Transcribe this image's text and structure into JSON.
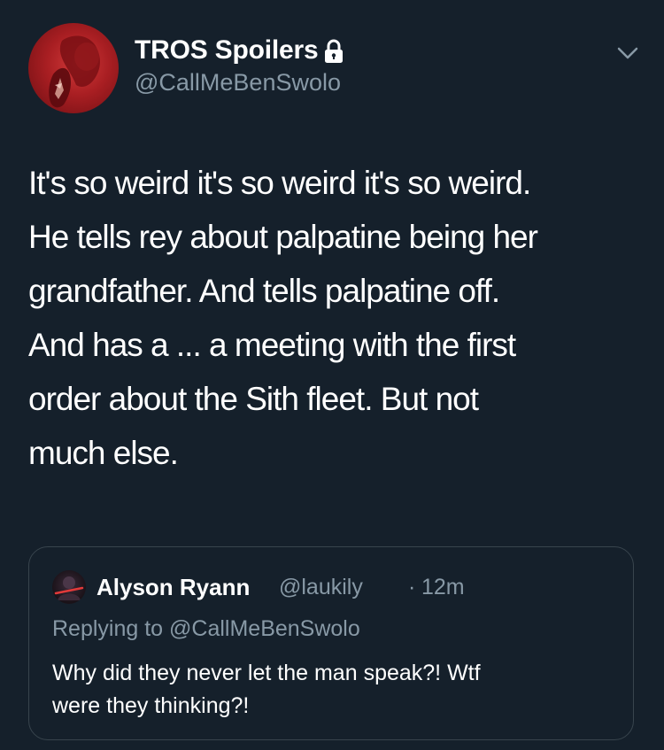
{
  "tweet": {
    "display_name": "TROS Spoilers",
    "handle": "@CallMeBenSwolo",
    "protected_icon": "lock-icon",
    "menu_icon": "chevron-down-icon",
    "text_lines": [
      "It's so weird it's so weird it's so weird.",
      "He tells rey about palpatine being her",
      "grandfather. And tells palpatine off.",
      "And has a ... a meeting with the first",
      "order about the Sith fleet. But not",
      "much else."
    ]
  },
  "quoted_tweet": {
    "display_name": "Alyson Ryann",
    "handle": "@laukily",
    "separator": "·",
    "time": "12m",
    "replying_to": "Replying to @CallMeBenSwolo",
    "text_lines": [
      "Why did they never let the man speak?! Wtf",
      "were they thinking?!"
    ]
  },
  "colors": {
    "background": "#15202b",
    "primary_text": "#ffffff",
    "secondary_text": "#8899a6",
    "border": "#38444d",
    "avatar_red": "#c42a2e"
  }
}
